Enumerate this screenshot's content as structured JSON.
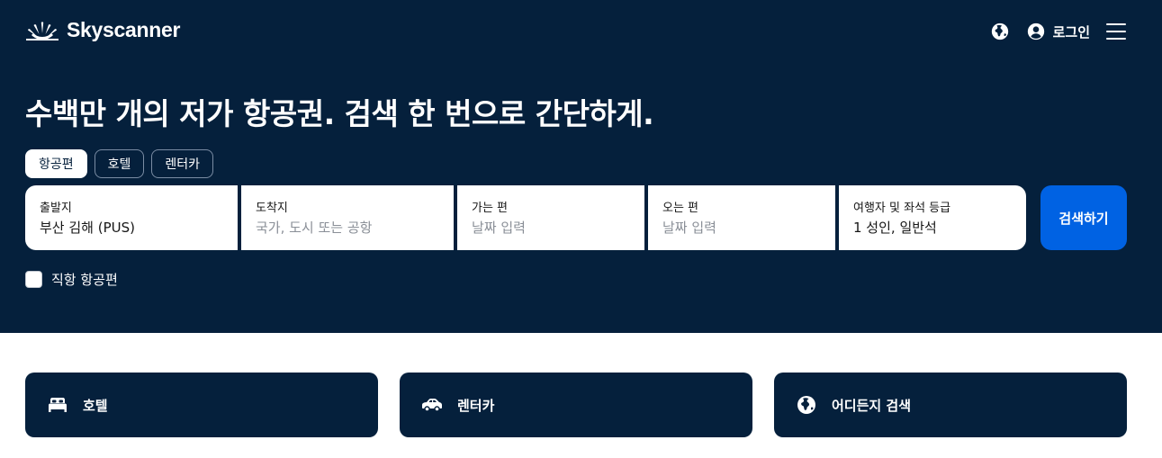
{
  "brand": {
    "name": "Skyscanner",
    "icon": "sunrise-logo-icon"
  },
  "header": {
    "login_label": "로그인",
    "icons": [
      "globe-icon",
      "account-icon",
      "menu-icon"
    ]
  },
  "hero": {
    "headline": "수백만 개의 저가 항공권. 검색 한 번으로 간단하게.",
    "tabs": [
      {
        "label": "항공편",
        "active": true
      },
      {
        "label": "호텔",
        "active": false
      },
      {
        "label": "렌터카",
        "active": false
      }
    ]
  },
  "search": {
    "from": {
      "label": "출발지",
      "value": "부산 김해 (PUS)"
    },
    "to": {
      "label": "도착지",
      "placeholder": "국가, 도시 또는 공항"
    },
    "depart": {
      "label": "가는 편",
      "placeholder": "날짜 입력"
    },
    "return": {
      "label": "오는 편",
      "placeholder": "날짜 입력"
    },
    "travellers": {
      "label": "여행자 및 좌석 등급",
      "value": "1 성인, 일반석"
    },
    "button_label": "검색하기",
    "direct_label": "직항 항공편",
    "direct_checked": false
  },
  "cards": [
    {
      "label": "호텔",
      "icon": "bed-icon"
    },
    {
      "label": "렌터카",
      "icon": "car-icon"
    },
    {
      "label": "어디든지 검색",
      "icon": "globe-icon"
    }
  ],
  "colors": {
    "navy": "#05203c",
    "primary": "#0062e3",
    "white": "#ffffff"
  }
}
